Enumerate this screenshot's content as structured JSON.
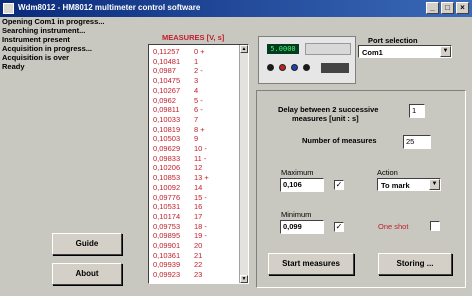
{
  "window": {
    "title": "Wdm8012 - HM8012 multimeter control software",
    "minimize": "_",
    "maximize": "□",
    "close": "×"
  },
  "log": [
    "Opening Com1 in progress...",
    "Searching instrument...",
    "Instrument present",
    "Acquisition in progress...",
    "Acquisition is over",
    "Ready"
  ],
  "buttons": {
    "guide": "Guide",
    "about": "About",
    "start": "Start measures",
    "storing": "Storing ..."
  },
  "measures": {
    "title": "MEASURES [V, s]",
    "rows": [
      {
        "v": "0,11257",
        "i": "0 +"
      },
      {
        "v": "0,10481",
        "i": "1"
      },
      {
        "v": "0,0987",
        "i": "2 -"
      },
      {
        "v": "0,10475",
        "i": "3"
      },
      {
        "v": "0,10267",
        "i": "4"
      },
      {
        "v": "0,0962",
        "i": "5 -"
      },
      {
        "v": "0,09811",
        "i": "6 -"
      },
      {
        "v": "0,10033",
        "i": "7"
      },
      {
        "v": "0,10819",
        "i": "8 +"
      },
      {
        "v": "0,10503",
        "i": "9"
      },
      {
        "v": "0,09629",
        "i": "10 -"
      },
      {
        "v": "0,09833",
        "i": "11 -"
      },
      {
        "v": "0,10206",
        "i": "12"
      },
      {
        "v": "0,10853",
        "i": "13 +"
      },
      {
        "v": "0,10092",
        "i": "14"
      },
      {
        "v": "0,09776",
        "i": "15 -"
      },
      {
        "v": "0,10531",
        "i": "16"
      },
      {
        "v": "0,10174",
        "i": "17"
      },
      {
        "v": "0,09753",
        "i": "18 -"
      },
      {
        "v": "0,09895",
        "i": "19 -"
      },
      {
        "v": "0,09901",
        "i": "20"
      },
      {
        "v": "0,10361",
        "i": "21"
      },
      {
        "v": "0,09939",
        "i": "22"
      },
      {
        "v": "0,09923",
        "i": "23"
      }
    ]
  },
  "device": {
    "display": "5.0000"
  },
  "port": {
    "label": "Port selection",
    "value": "Com1"
  },
  "settings": {
    "delay_label_1": "Delay between 2 successive",
    "delay_label_2": "measures [unit : s]",
    "delay_value": "1",
    "count_label": "Number of measures",
    "count_value": "25",
    "max_label": "Maximum",
    "max_value": "0,106",
    "min_label": "Minimum",
    "min_value": "0,099",
    "action_label": "Action",
    "action_value": "To mark",
    "oneshot_label": "One shot",
    "check_mark": "✓"
  }
}
